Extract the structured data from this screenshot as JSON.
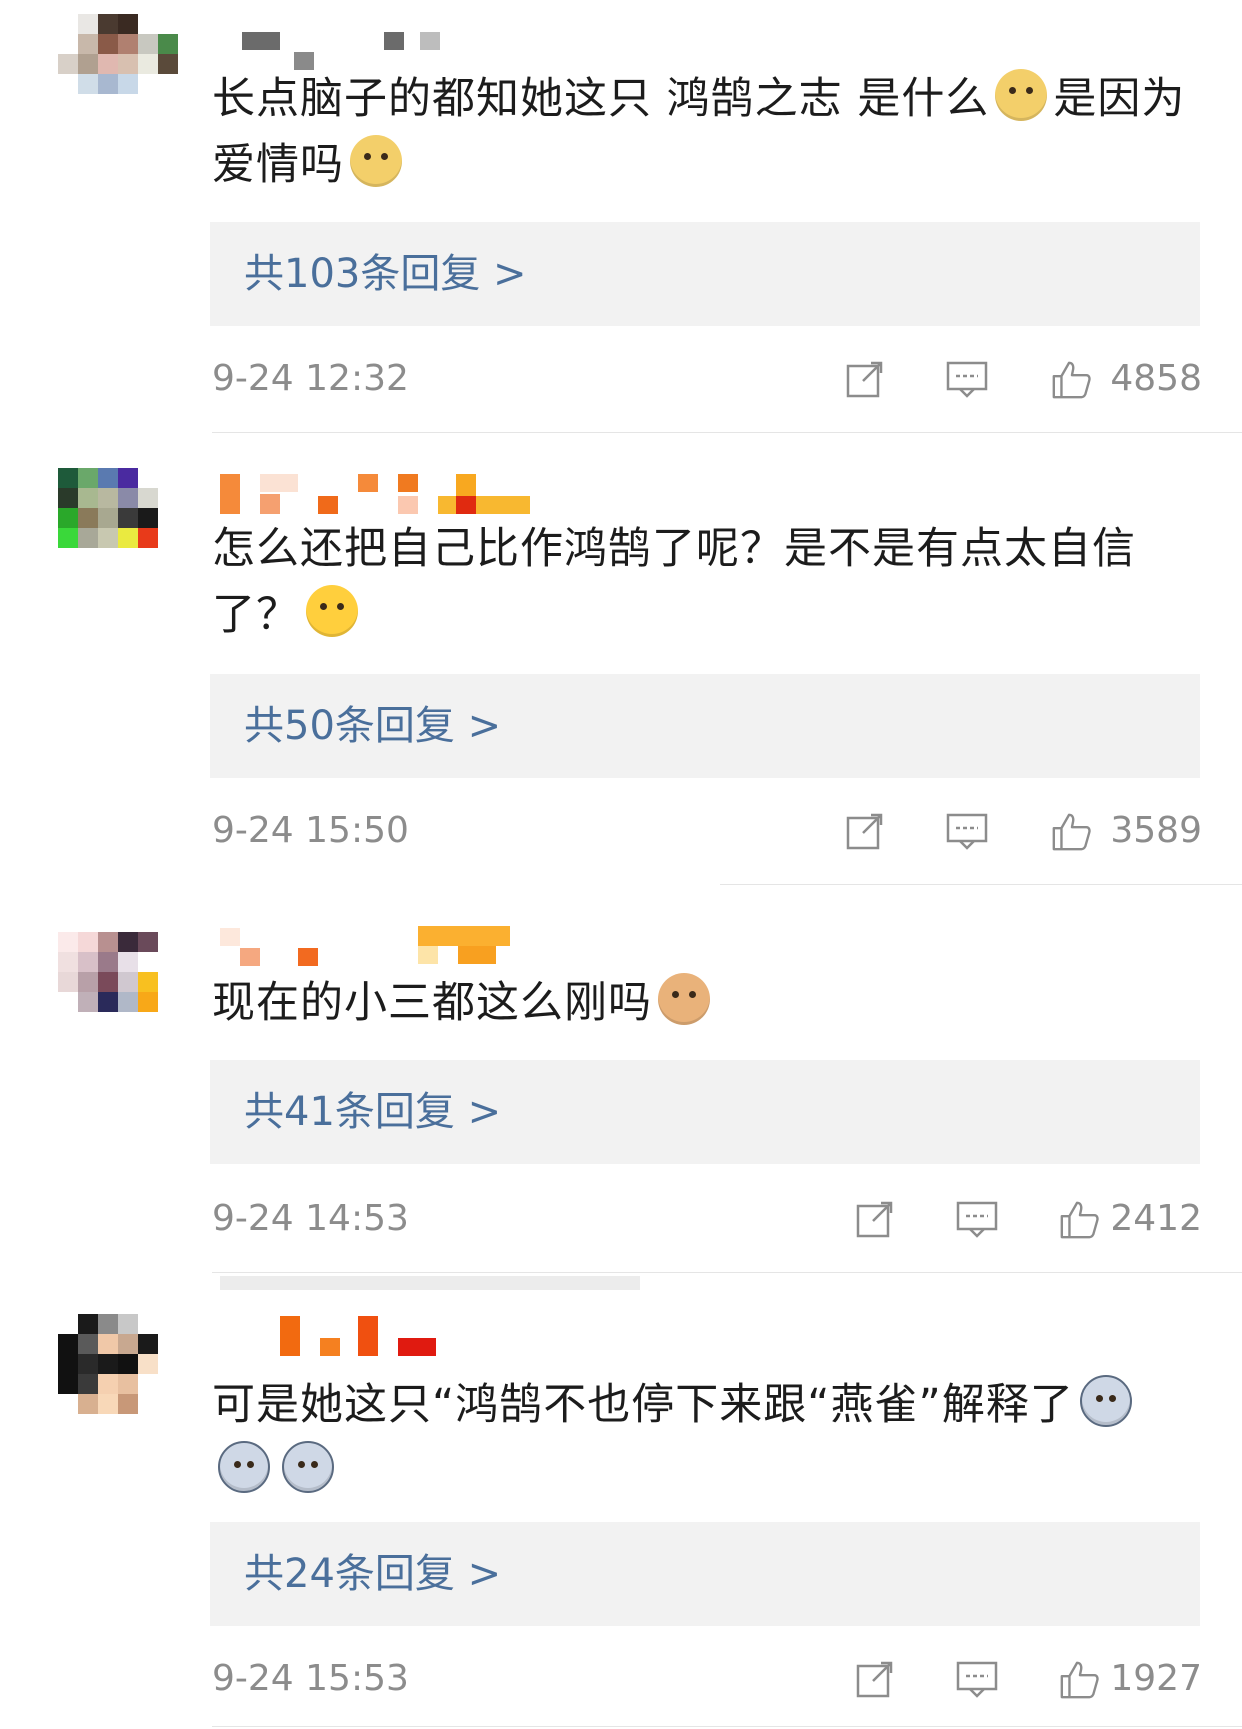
{
  "comments": [
    {
      "text": "长点脑子的都知她这只 鸿鹄之志 是什么",
      "text_tail": "是因为爱情吗",
      "emoji_inline": "doge-icon",
      "emoji_end": "doge-icon",
      "replies_label": "共103条回复 >",
      "time": "9-24 12:32",
      "likes": "4858"
    },
    {
      "text": "怎么还把自己比作鸿鹄了呢？是不是有点太自信了？",
      "emoji_end": "laugh-cry-icon",
      "replies_label": "共50条回复 >",
      "time": "9-24 15:50",
      "likes": "3589"
    },
    {
      "text": "现在的小三都这么刚吗",
      "emoji_end": "cat-icon",
      "replies_label": "共41条回复 >",
      "time": "9-24 14:53",
      "likes": "2412"
    },
    {
      "text": "可是她这只“鸿鹄不也停下来跟“燕雀”解释了",
      "emoji_end": "husky-icon",
      "replies_label": "共24条回复 >",
      "time": "9-24 15:53",
      "likes": "1927"
    }
  ],
  "icons": {
    "share": "share-icon",
    "comment": "comment-icon",
    "like": "thumbs-up-icon"
  },
  "colors": {
    "link_blue": "#4a6f9b",
    "reply_box_bg": "#f2f2f2",
    "meta_gray": "#8c8c8c"
  }
}
